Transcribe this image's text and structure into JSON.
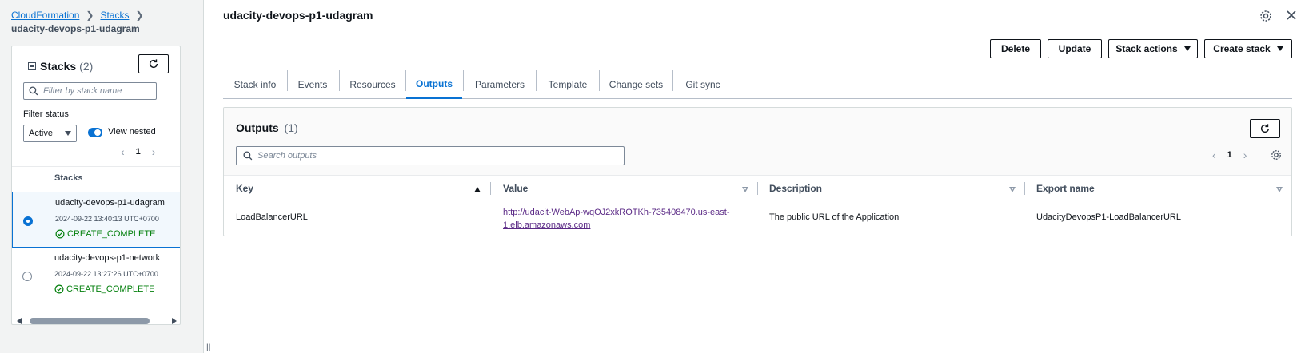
{
  "breadcrumb": {
    "items": [
      "CloudFormation",
      "Stacks"
    ],
    "current": "udacity-devops-p1-udagram"
  },
  "stacks_panel": {
    "title": "Stacks",
    "count": "(2)",
    "filter_placeholder": "Filter by stack name",
    "filter_status_label": "Filter status",
    "status_value": "Active",
    "view_nested_label": "View nested",
    "page": "1",
    "column_header": "Stacks",
    "rows": [
      {
        "name": "udacity-devops-p1-udagram",
        "date": "2024-09-22 13:40:13 UTC+0700",
        "status": "CREATE_COMPLETE",
        "selected": true
      },
      {
        "name": "udacity-devops-p1-network",
        "date": "2024-09-22 13:27:26 UTC+0700",
        "status": "CREATE_COMPLETE",
        "selected": false
      }
    ]
  },
  "main": {
    "title": "udacity-devops-p1-udagram",
    "actions": {
      "delete": "Delete",
      "update": "Update",
      "stack_actions": "Stack actions",
      "create_stack": "Create stack"
    },
    "tabs": [
      "Stack info",
      "Events",
      "Resources",
      "Outputs",
      "Parameters",
      "Template",
      "Change sets",
      "Git sync"
    ],
    "active_tab": "Outputs"
  },
  "outputs": {
    "title": "Outputs",
    "count": "(1)",
    "search_placeholder": "Search outputs",
    "page": "1",
    "columns": [
      "Key",
      "Value",
      "Description",
      "Export name"
    ],
    "rows": [
      {
        "key": "LoadBalancerURL",
        "value_line1": "http://udacit-WebAp-wqOJ2xkROTKh-735408470.us-east-",
        "value_line2": "1.elb.amazonaws.com",
        "description": "The public URL of the Application",
        "export_name": "UdacityDevopsP1-LoadBalancerURL"
      }
    ]
  },
  "colors": {
    "accent": "#0972d3",
    "success": "#037f0c",
    "link_visited": "#5b2a86"
  },
  "icons": {
    "refresh": "refresh-icon",
    "search": "search-icon",
    "settings": "gear-icon",
    "close": "close-icon",
    "status_ok": "check-circle-icon"
  }
}
